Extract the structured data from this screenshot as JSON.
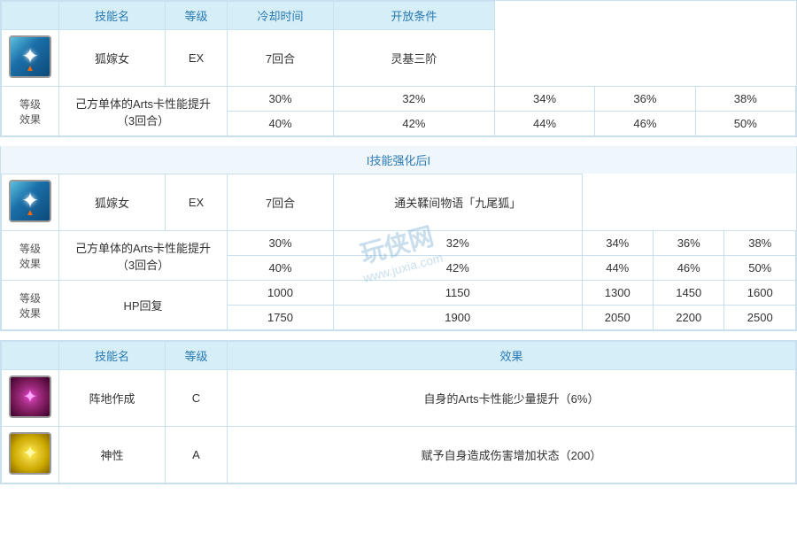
{
  "sections": {
    "before_enhance": {
      "headers": {
        "skill_name": "技能名",
        "level": "等级",
        "cooldown": "冷却时间",
        "condition": "开放条件"
      },
      "skill_row": {
        "name": "狐嫁女",
        "level": "EX",
        "cooldown": "7回合",
        "condition": "灵基三阶"
      },
      "grade_rows": [
        {
          "label": "等级\n效果",
          "desc": "己方单体的Arts卡性能提升（3回合）",
          "values_row1": [
            "30%",
            "32%",
            "34%",
            "36%",
            "38%"
          ],
          "values_row2": [
            "40%",
            "42%",
            "44%",
            "46%",
            "50%"
          ]
        }
      ]
    },
    "enhanced_label": "I技能强化后I",
    "after_enhance": {
      "skill_row": {
        "name": "狐嫁女",
        "level": "EX",
        "cooldown": "7回合",
        "condition": "通关鞣间物语「九尾狐」"
      },
      "grade_rows": [
        {
          "label": "等级\n效果",
          "desc": "己方单体的Arts卡性能提升（3回合）",
          "values_row1": [
            "30%",
            "32%",
            "34%",
            "36%",
            "38%"
          ],
          "values_row2": [
            "40%",
            "42%",
            "44%",
            "46%",
            "50%"
          ]
        },
        {
          "label": "等级\n效果",
          "desc": "HP回复",
          "values_row1": [
            "1000",
            "1150",
            "1300",
            "1450",
            "1600"
          ],
          "values_row2": [
            "1750",
            "1900",
            "2050",
            "2200",
            "2500"
          ]
        }
      ]
    },
    "passive": {
      "headers": {
        "skill_name": "技能名",
        "level": "等级",
        "effect": "效果"
      },
      "skills": [
        {
          "name": "阵地作成",
          "level": "C",
          "effect": "自身的Arts卡性能少量提升（6%）",
          "icon_type": "ground"
        },
        {
          "name": "神性",
          "level": "A",
          "effect": "赋予自身造成伤害增加状态（200）",
          "icon_type": "divine"
        }
      ]
    }
  },
  "watermark": {
    "line1": "玩侠网",
    "line2": "www.juxia.com"
  }
}
